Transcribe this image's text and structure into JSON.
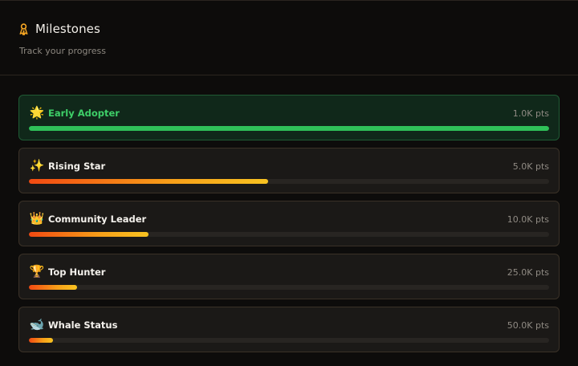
{
  "header": {
    "icon": "medal-icon",
    "title": "Milestones",
    "subtitle": "Track your progress"
  },
  "colors": {
    "accent": "#f5a623",
    "complete": "#2fc159",
    "complete_text": "#3ecf68",
    "progress_start": "#f24a12",
    "progress_end": "#f8c321"
  },
  "milestones": [
    {
      "emoji": "🌟",
      "icon": "glowing-star-icon",
      "name": "Early Adopter",
      "points": "1.0K pts",
      "progress": 1.0,
      "complete": true
    },
    {
      "emoji": "✨",
      "icon": "sparkles-icon",
      "name": "Rising Star",
      "points": "5.0K pts",
      "progress": 0.46,
      "complete": false
    },
    {
      "emoji": "👑",
      "icon": "crown-icon",
      "name": "Community Leader",
      "points": "10.0K pts",
      "progress": 0.23,
      "complete": false
    },
    {
      "emoji": "🏆",
      "icon": "trophy-icon",
      "name": "Top Hunter",
      "points": "25.0K pts",
      "progress": 0.092,
      "complete": false
    },
    {
      "emoji": "🐋",
      "icon": "whale-icon",
      "name": "Whale Status",
      "points": "50.0K pts",
      "progress": 0.046,
      "complete": false
    }
  ]
}
